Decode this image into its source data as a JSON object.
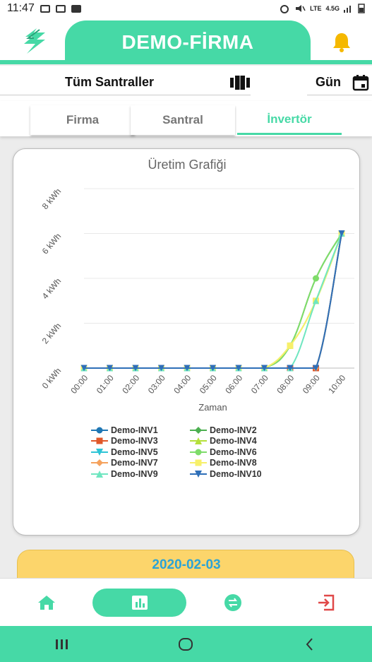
{
  "status_bar": {
    "time": "11:47",
    "network": "4.5G"
  },
  "header": {
    "title": "DEMO-FİRMA"
  },
  "filters": {
    "santral": "Tüm Santraller",
    "period": "Gün"
  },
  "tabs": [
    {
      "label": "Firma",
      "active": false
    },
    {
      "label": "Santral",
      "active": false
    },
    {
      "label": "İnvertör",
      "active": true
    }
  ],
  "colors": {
    "accent": "#46d9a6",
    "date_card": "#fcd56b",
    "date_text": "#2ba3d6",
    "bell": "#f5b800"
  },
  "chart_data": {
    "type": "line",
    "title": "Üretim Grafiği",
    "xlabel": "Zaman",
    "ylabel": "",
    "ylim": [
      0,
      8
    ],
    "yticks": [
      "0 kWh",
      "2 kWh",
      "4 kWh",
      "6 kWh",
      "8 kWh"
    ],
    "ytick_values": [
      0,
      2,
      4,
      6,
      8
    ],
    "categories": [
      "00:00",
      "01:00",
      "02:00",
      "03:00",
      "04:00",
      "05:00",
      "06:00",
      "07:00",
      "08:00",
      "09:00",
      "10:00"
    ],
    "legend_placement": "bottom",
    "series": [
      {
        "name": "Demo-INV1",
        "color": "#1f77b4",
        "marker": "circle",
        "values": [
          0,
          0,
          0,
          0,
          0,
          0,
          0,
          0,
          0,
          0,
          6
        ]
      },
      {
        "name": "Demo-INV2",
        "color": "#4caf50",
        "marker": "diamond",
        "values": [
          0,
          0,
          0,
          0,
          0,
          0,
          0,
          0,
          1,
          4,
          6
        ]
      },
      {
        "name": "Demo-INV3",
        "color": "#e0582a",
        "marker": "square",
        "values": [
          0,
          0,
          0,
          0,
          0,
          0,
          0,
          0,
          0,
          0,
          6
        ]
      },
      {
        "name": "Demo-INV4",
        "color": "#b5e03a",
        "marker": "triangle",
        "values": [
          0,
          0,
          0,
          0,
          0,
          0,
          0,
          0,
          1,
          3,
          6
        ]
      },
      {
        "name": "Demo-INV5",
        "color": "#2ec4d6",
        "marker": "triangle-down",
        "values": [
          0,
          0,
          0,
          0,
          0,
          0,
          0,
          0,
          0,
          0,
          6
        ]
      },
      {
        "name": "Demo-INV6",
        "color": "#7fdc6a",
        "marker": "circle",
        "values": [
          0,
          0,
          0,
          0,
          0,
          0,
          0,
          0,
          1,
          4,
          6
        ]
      },
      {
        "name": "Demo-INV7",
        "color": "#f5a25d",
        "marker": "diamond",
        "values": [
          0,
          0,
          0,
          0,
          0,
          0,
          0,
          0,
          0,
          0,
          6
        ]
      },
      {
        "name": "Demo-INV8",
        "color": "#f7f06a",
        "marker": "square",
        "values": [
          0,
          0,
          0,
          0,
          0,
          0,
          0,
          0,
          1,
          3,
          6
        ]
      },
      {
        "name": "Demo-INV9",
        "color": "#6fe6c0",
        "marker": "triangle",
        "values": [
          0,
          0,
          0,
          0,
          0,
          0,
          0,
          0,
          0,
          3,
          6
        ]
      },
      {
        "name": "Demo-INV10",
        "color": "#2f6fb8",
        "marker": "triangle-down",
        "values": [
          0,
          0,
          0,
          0,
          0,
          0,
          0,
          0,
          0,
          0,
          6
        ]
      }
    ]
  },
  "date_card": {
    "date": "2020-02-03"
  },
  "bottom_nav": [
    {
      "icon": "home-icon",
      "active": false
    },
    {
      "icon": "chart-icon",
      "active": true
    },
    {
      "icon": "transfer-icon",
      "active": false
    },
    {
      "icon": "logout-icon",
      "active": false
    }
  ],
  "android_nav": [
    "recent-apps-icon",
    "home-circle-icon",
    "back-icon"
  ]
}
